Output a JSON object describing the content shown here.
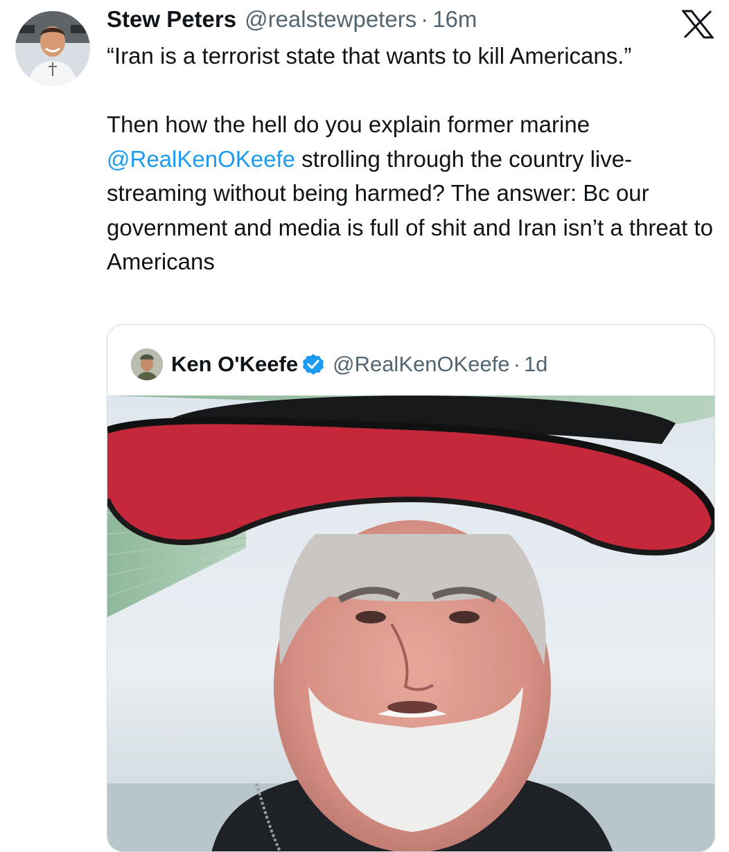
{
  "tweet": {
    "author_name": "Stew Peters",
    "author_handle": "@realstewpeters",
    "separator": "·",
    "time": "16m",
    "text_line1": "“Iran is a terrorist state that wants to kill Americans.”",
    "text_before_mention": "Then how the hell do you explain former marine ",
    "mention": "@RealKenOKeefe",
    "text_after_mention": " strolling through the country live-streaming without being harmed? The answer: Bc our government and media is full of shit and Iran isn’t a threat to Americans"
  },
  "quote": {
    "author_name": "Ken O'Keefe",
    "author_handle": "@RealKenOKeefe",
    "separator": "·",
    "time": "1d",
    "verified": true
  },
  "icons": {
    "platform_logo": "x-logo-icon",
    "verified": "verified-badge-icon"
  },
  "colors": {
    "text": "#0f1419",
    "secondary": "#536471",
    "link": "#1d9bf0",
    "border": "#cfd9de"
  }
}
